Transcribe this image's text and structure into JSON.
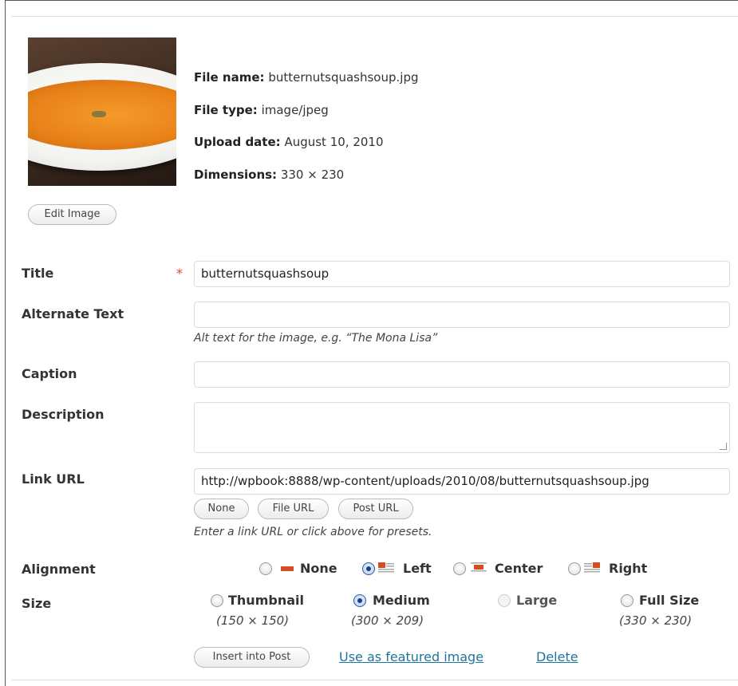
{
  "file_info": {
    "file_name_label": "File name:",
    "file_name": "butternutsquashsoup.jpg",
    "file_type_label": "File type:",
    "file_type": "image/jpeg",
    "upload_date_label": "Upload date:",
    "upload_date": "August 10, 2010",
    "dimensions_label": "Dimensions:",
    "dimensions": "330 × 230"
  },
  "edit_image_label": "Edit Image",
  "fields": {
    "title_label": "Title",
    "required_marker": "*",
    "title_value": "butternutsquashsoup",
    "alt_label": "Alternate Text",
    "alt_value": "",
    "alt_help": "Alt text for the image, e.g. “The Mona Lisa”",
    "caption_label": "Caption",
    "caption_value": "",
    "description_label": "Description",
    "description_value": "",
    "link_url_label": "Link URL",
    "link_url_value": "http://wpbook:8888/wp-content/uploads/2010/08/butternutsquashsoup.jpg",
    "link_buttons": [
      "None",
      "File URL",
      "Post URL"
    ],
    "link_help": "Enter a link URL or click above for presets."
  },
  "alignment": {
    "label": "Alignment",
    "selected": "Left",
    "options": [
      "None",
      "Left",
      "Center",
      "Right"
    ]
  },
  "size": {
    "label": "Size",
    "selected": "Medium",
    "options": [
      {
        "label": "Thumbnail",
        "dims": "(150 × 150)",
        "enabled": true
      },
      {
        "label": "Medium",
        "dims": "(300 × 209)",
        "enabled": true
      },
      {
        "label": "Large",
        "dims": "",
        "enabled": false
      },
      {
        "label": "Full Size",
        "dims": "(330 × 230)",
        "enabled": true
      }
    ]
  },
  "actions": {
    "insert_label": "Insert into Post",
    "featured_label": "Use as featured image",
    "delete_label": "Delete"
  },
  "colors": {
    "link": "#21759b",
    "required": "#d54e21",
    "align_icon_accent": "#d54e21"
  }
}
